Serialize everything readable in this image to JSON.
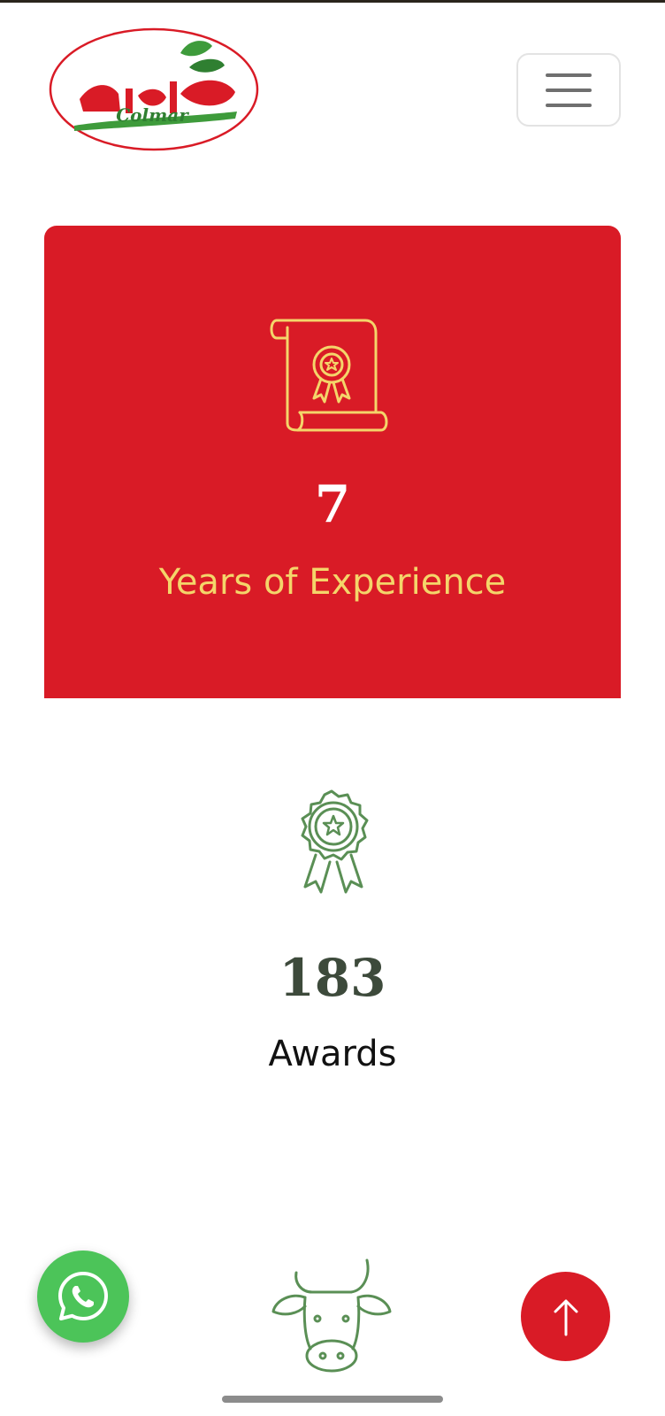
{
  "header": {
    "logo": {
      "arabic_text": "كولمار",
      "latin_text": "Colmar"
    },
    "menu_icon": "hamburger-menu-icon"
  },
  "stats": [
    {
      "icon": "certificate-icon",
      "value": "7",
      "label": "Years of Experience",
      "background": "#d91b26",
      "value_color": "#ffffff",
      "label_color": "#f4d56a"
    },
    {
      "icon": "award-ribbon-icon",
      "value": "183",
      "label": "Awards",
      "background": "#ffffff",
      "value_color": "#3d4a3b",
      "label_color": "#111111"
    },
    {
      "icon": "cow-icon"
    }
  ],
  "floating": {
    "whatsapp_icon": "whatsapp-icon",
    "back_to_top_icon": "arrow-up-icon"
  },
  "colors": {
    "brand_red": "#d91b26",
    "brand_green": "#4e8f4c",
    "gold": "#f4d56a",
    "whatsapp_green": "#4cc459"
  }
}
